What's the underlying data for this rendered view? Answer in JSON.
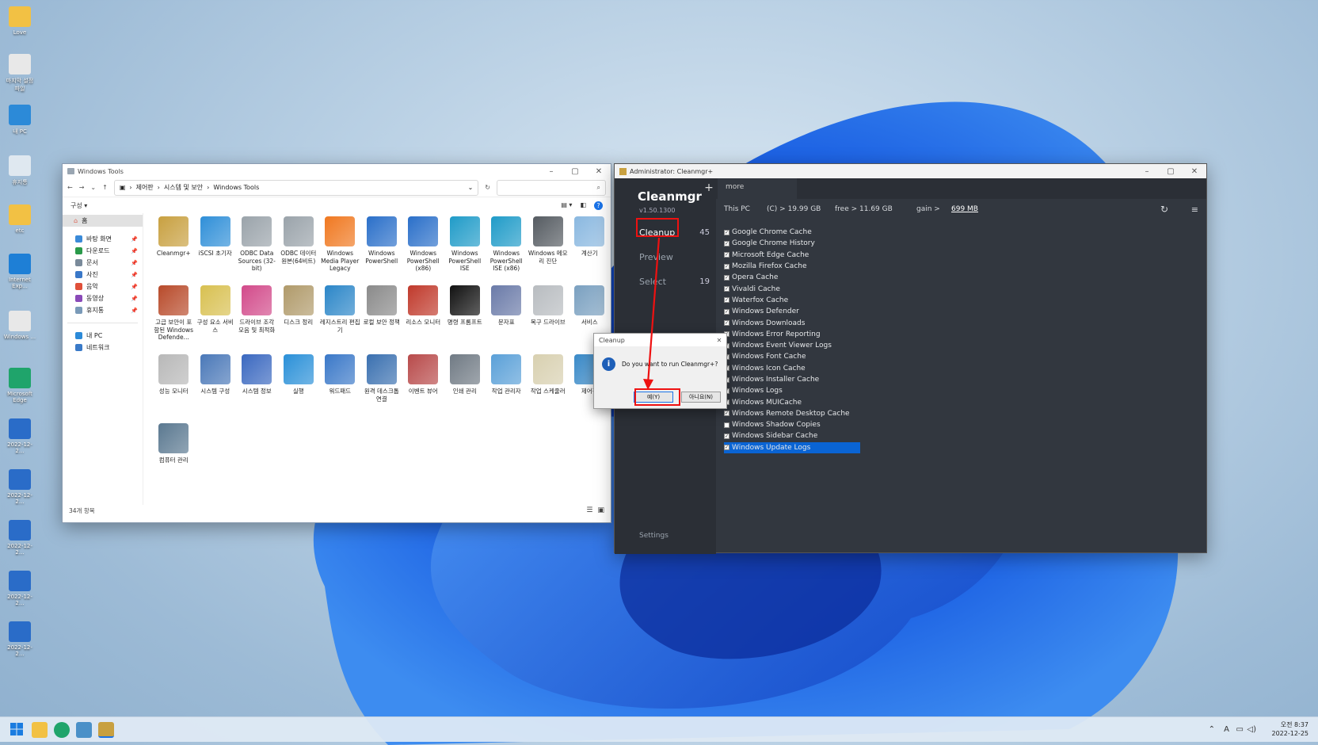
{
  "desktop": {
    "icons": [
      {
        "label": "Love",
        "name": "love-folder-icon",
        "color": "#f2c144"
      },
      {
        "label": "마지막 설정 파일",
        "name": "settings-shortcut-icon",
        "color": "#e8e8e8"
      },
      {
        "label": "내 PC",
        "name": "this-pc-icon",
        "color": "#2c8ad8"
      },
      {
        "label": "휴지통",
        "name": "recycle-bin-icon",
        "color": "#dfe8f0"
      },
      {
        "label": "etc",
        "name": "etc-folder-icon",
        "color": "#f2c144"
      },
      {
        "label": "Internet Exp...",
        "name": "internet-explorer-icon",
        "color": "#1e7fd6"
      },
      {
        "label": "Windows ...",
        "name": "windows-tools-icon",
        "color": "#e8e8e8"
      },
      {
        "label": "Microsoft Edge",
        "name": "edge-icon",
        "color": "#1fa46b"
      },
      {
        "label": "2022-12-2...",
        "name": "screenshot-file-icon",
        "color": "#2a6cc8"
      },
      {
        "label": "2022-12-2...",
        "name": "screenshot-file-icon",
        "color": "#2a6cc8"
      },
      {
        "label": "2022-12-2...",
        "name": "screenshot-file-icon",
        "color": "#2a6cc8"
      },
      {
        "label": "2022-12-2...",
        "name": "screenshot-file-icon",
        "color": "#2a6cc8"
      },
      {
        "label": "2022-12-2...",
        "name": "screenshot-file-icon",
        "color": "#2a6cc8"
      }
    ]
  },
  "explorer": {
    "title": "Windows Tools",
    "breadcrumb": [
      "제어판",
      "시스템 및 보안",
      "Windows Tools"
    ],
    "organize": "구성 ▾",
    "nav": {
      "home": "홈",
      "quick": [
        "바탕 화면",
        "다운로드",
        "문서",
        "사진",
        "음악",
        "동영상",
        "휴지통"
      ],
      "pc": "내 PC",
      "network": "네트워크"
    },
    "items": [
      {
        "label": "Cleanmgr+",
        "color": "#c8a040"
      },
      {
        "label": "iSCSI 초기자",
        "color": "#2f8fd8"
      },
      {
        "label": "ODBC Data Sources (32-bit)",
        "color": "#9aa3aa"
      },
      {
        "label": "ODBC 데이터 원본(64비트)",
        "color": "#9aa3aa"
      },
      {
        "label": "Windows Media Player Legacy",
        "color": "#f07820"
      },
      {
        "label": "Windows PowerShell",
        "color": "#2a6fc9"
      },
      {
        "label": "Windows PowerShell (x86)",
        "color": "#2a6fc9"
      },
      {
        "label": "Windows PowerShell ISE",
        "color": "#1f9bc8"
      },
      {
        "label": "Windows PowerShell ISE (x86)",
        "color": "#1f9bc8"
      },
      {
        "label": "Windows 메모리 진단",
        "color": "#555b61"
      },
      {
        "label": "계산기",
        "color": "#8ab8e0"
      },
      {
        "label": "고급 보안이 포함된 Windows Defende...",
        "color": "#b84a2a"
      },
      {
        "label": "구성 요소 서비스",
        "color": "#d8c050"
      },
      {
        "label": "드라이브 조각 모음 및 최적화",
        "color": "#d24a8a"
      },
      {
        "label": "디스크 정리",
        "color": "#b09a6a"
      },
      {
        "label": "레지스트리 편집기",
        "color": "#2b86c8"
      },
      {
        "label": "로컬 보안 정책",
        "color": "#8a8a8a"
      },
      {
        "label": "리소스 모니터",
        "color": "#c0392b"
      },
      {
        "label": "명령 프롬프트",
        "color": "#111111"
      },
      {
        "label": "문자표",
        "color": "#6a7aa8"
      },
      {
        "label": "복구 드라이브",
        "color": "#b8bcc0"
      },
      {
        "label": "서비스",
        "color": "#7aa0c0"
      },
      {
        "label": "성능 모니터",
        "color": "#b8b8b8"
      },
      {
        "label": "시스템 구성",
        "color": "#4a78b8"
      },
      {
        "label": "시스템 정보",
        "color": "#3a68c0"
      },
      {
        "label": "실행",
        "color": "#2a90d8"
      },
      {
        "label": "워드패드",
        "color": "#3a78c8"
      },
      {
        "label": "원격 데스크톱 연결",
        "color": "#3a70b0"
      },
      {
        "label": "이벤트 뷰어",
        "color": "#b84a4a"
      },
      {
        "label": "인쇄 관리",
        "color": "#707a84"
      },
      {
        "label": "작업 관리자",
        "color": "#5aa0d8"
      },
      {
        "label": "작업 스케줄러",
        "color": "#d8d0b0"
      },
      {
        "label": "제어판",
        "color": "#3a8ac8"
      },
      {
        "label": "컴퓨터 관리",
        "color": "#5a7890"
      }
    ],
    "status": "34개 항목"
  },
  "cleanmgr": {
    "window_title": "Administrator: Cleanmgr+",
    "app_name": "Cleanmgr",
    "version": "v1.50.1300",
    "nav": {
      "cleanup": "Cleanup",
      "cleanup_count": "45",
      "preview": "Preview",
      "select": "Select",
      "select_count": "19",
      "settings": "Settings"
    },
    "tab_more": "more",
    "info": {
      "pc": "This PC",
      "drive": "(C) > 19.99 GB",
      "free": "free > 11.69 GB",
      "gain_label": "gain >",
      "gain_value": "699 MB"
    },
    "items": [
      {
        "label": "Google Chrome Cache",
        "checked": true
      },
      {
        "label": "Google Chrome History",
        "checked": true
      },
      {
        "label": "Microsoft Edge Cache",
        "checked": true
      },
      {
        "label": "Mozilla Firefox Cache",
        "checked": true
      },
      {
        "label": "Opera Cache",
        "checked": true
      },
      {
        "label": "Vivaldi Cache",
        "checked": true
      },
      {
        "label": "Waterfox Cache",
        "checked": true
      },
      {
        "label": "Windows Defender",
        "checked": true
      },
      {
        "label": "Windows Downloads",
        "checked": true
      },
      {
        "label": "Windows Error Reporting",
        "checked": true
      },
      {
        "label": "Windows Event Viewer Logs",
        "checked": true
      },
      {
        "label": "Windows Font Cache",
        "checked": true
      },
      {
        "label": "Windows Icon Cache",
        "checked": true
      },
      {
        "label": "Windows Installer Cache",
        "checked": true
      },
      {
        "label": "Windows Logs",
        "checked": true
      },
      {
        "label": "Windows MUICache",
        "checked": true
      },
      {
        "label": "Windows Remote Desktop Cache",
        "checked": true
      },
      {
        "label": "Windows Shadow Copies",
        "checked": false
      },
      {
        "label": "Windows Sidebar Cache",
        "checked": true
      },
      {
        "label": "Windows Update Logs",
        "checked": true,
        "selected": true
      }
    ]
  },
  "dialog": {
    "title": "Cleanup",
    "message": "Do you want to run Cleanmgr+?",
    "yes": "예(Y)",
    "no": "아니요(N)"
  },
  "taskbar": {
    "time": "오전 8:37",
    "date": "2022-12-25",
    "ime": "A"
  },
  "colors": {
    "accent": "#0a64d4",
    "highlight": "#e11111"
  }
}
